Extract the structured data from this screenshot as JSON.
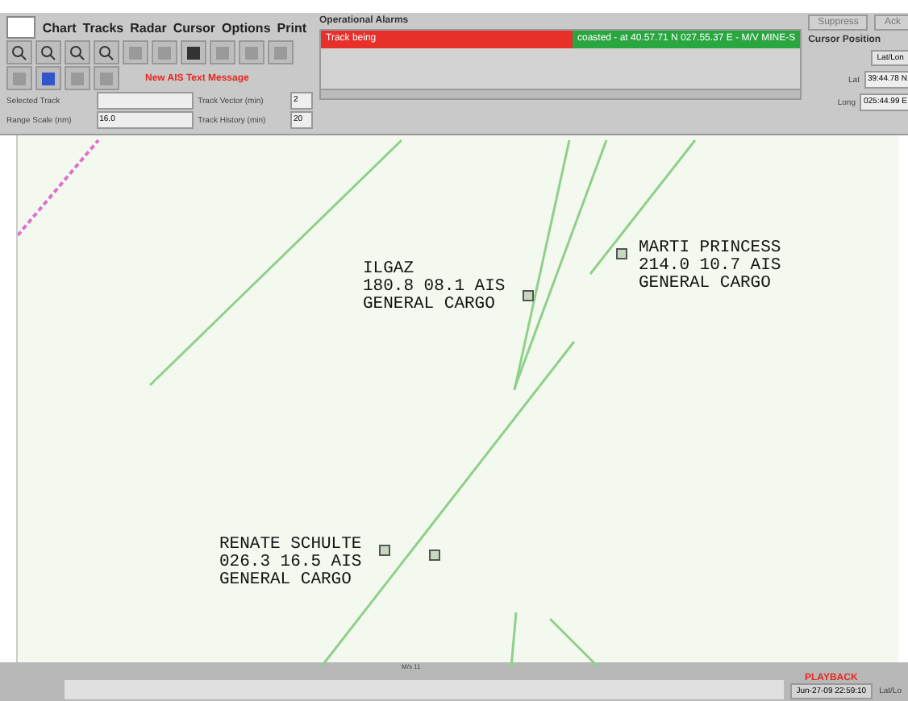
{
  "menu": [
    "Chart",
    "Tracks",
    "Radar",
    "Cursor",
    "Options",
    "Print"
  ],
  "message": "New AIS Text Message",
  "fields": [
    {
      "label": "Selected Track"
    },
    {
      "label": "Track Vector (min)",
      "value": "2"
    },
    {
      "label": "Range Scale (nm)",
      "value": "16.0"
    },
    {
      "label": "Track History (min)",
      "value": "20"
    }
  ],
  "alarms": {
    "title": "Operational Alarms",
    "buttons": [
      "Suppress",
      "Ack"
    ],
    "items": [
      {
        "text": "Track being",
        "color": "#e8302a"
      },
      {
        "text": "coasted - at 40.57.71 N 027.55.37 E - M/V MINE-S",
        "color": "#2aa640"
      }
    ]
  },
  "cursor_position": {
    "title": "Cursor Position",
    "mode": "Lat/Lon",
    "rows": [
      {
        "label": "Lat",
        "value": "39:44.78 N"
      },
      {
        "label": "Long",
        "value": "025:44.99 E"
      }
    ]
  },
  "vessels": [
    {
      "name": "ILGAZ",
      "info": "180.8 08.1 AIS",
      "type": "GENERAL CARGO"
    },
    {
      "name": "MARTI PRINCESS",
      "info": "214.0 10.7 AIS",
      "type": "GENERAL CARGO"
    },
    {
      "name": "RENATE SCHULTE",
      "info": "026.3 16.5 AIS",
      "type": "GENERAL CARGO"
    }
  ],
  "map_mark": "M/s 11",
  "status": {
    "mode": "PLAYBACK",
    "time": "Jun-27-09 22:59:10",
    "unit": "Lat/Lo"
  }
}
